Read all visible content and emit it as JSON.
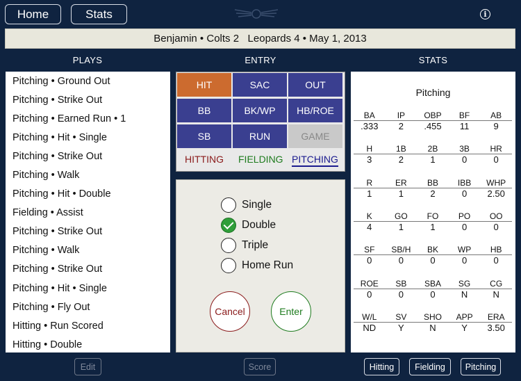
{
  "header": {
    "home_label": "Home",
    "stats_label": "Stats",
    "game_info": "Benjamin • Colts 2   Leopards 4 • May 1, 2013"
  },
  "columns": {
    "plays": "PLAYS",
    "entry": "ENTRY",
    "stats": "STATS"
  },
  "plays": [
    "Pitching • Ground Out",
    "Pitching • Strike Out",
    "Pitching • Earned Run • 1",
    "Pitching • Hit • Single",
    "Pitching • Strike Out",
    "Pitching • Walk",
    "Pitching • Hit • Double",
    "Fielding • Assist",
    "Pitching • Strike Out",
    "Pitching • Walk",
    "Pitching • Strike Out",
    "Pitching • Hit • Single",
    "Pitching • Fly Out",
    "Hitting • Run Scored",
    "Hitting • Double"
  ],
  "entry": {
    "grid": [
      [
        "HIT",
        "SAC",
        "OUT"
      ],
      [
        "BB",
        "BK/WP",
        "HB/ROE"
      ],
      [
        "SB",
        "RUN",
        "GAME"
      ]
    ],
    "modes": {
      "hitting": "HITTING",
      "fielding": "FIELDING",
      "pitching": "PITCHING"
    },
    "selected_mode": "PITCHING",
    "selected_action": "HIT",
    "options": [
      "Single",
      "Double",
      "Triple",
      "Home Run"
    ],
    "selected_option": "Double",
    "cancel_label": "Cancel",
    "enter_label": "Enter"
  },
  "stats": {
    "title": "Pitching",
    "groups": [
      {
        "headers": [
          "BA",
          "IP",
          "OBP",
          "BF",
          "AB"
        ],
        "values": [
          ".333",
          "2",
          ".455",
          "11",
          "9"
        ]
      },
      {
        "headers": [
          "H",
          "1B",
          "2B",
          "3B",
          "HR"
        ],
        "values": [
          "3",
          "2",
          "1",
          "0",
          "0"
        ]
      },
      {
        "headers": [
          "R",
          "ER",
          "BB",
          "IBB",
          "WHP"
        ],
        "values": [
          "1",
          "1",
          "2",
          "0",
          "2.50"
        ]
      },
      {
        "headers": [
          "K",
          "GO",
          "FO",
          "PO",
          "OO"
        ],
        "values": [
          "4",
          "1",
          "1",
          "0",
          "0"
        ]
      },
      {
        "headers": [
          "SF",
          "SB/H",
          "BK",
          "WP",
          "HB"
        ],
        "values": [
          "0",
          "0",
          "0",
          "0",
          "0"
        ]
      },
      {
        "headers": [
          "ROE",
          "SB",
          "SBA",
          "SG",
          "CG"
        ],
        "values": [
          "0",
          "0",
          "0",
          "N",
          "N"
        ]
      },
      {
        "headers": [
          "W/L",
          "SV",
          "SHO",
          "APP",
          "ERA"
        ],
        "values": [
          "ND",
          "Y",
          "N",
          "Y",
          "3.50"
        ]
      }
    ]
  },
  "footer": {
    "edit_label": "Edit",
    "score_label": "Score",
    "hitting_label": "Hitting",
    "fielding_label": "Fielding",
    "pitching_label": "Pitching"
  },
  "colors": {
    "background": "#0f2340",
    "grid_cell": "#3a3f90",
    "hit_selected": "#cc6b2f",
    "check_green": "#2f9e39"
  }
}
